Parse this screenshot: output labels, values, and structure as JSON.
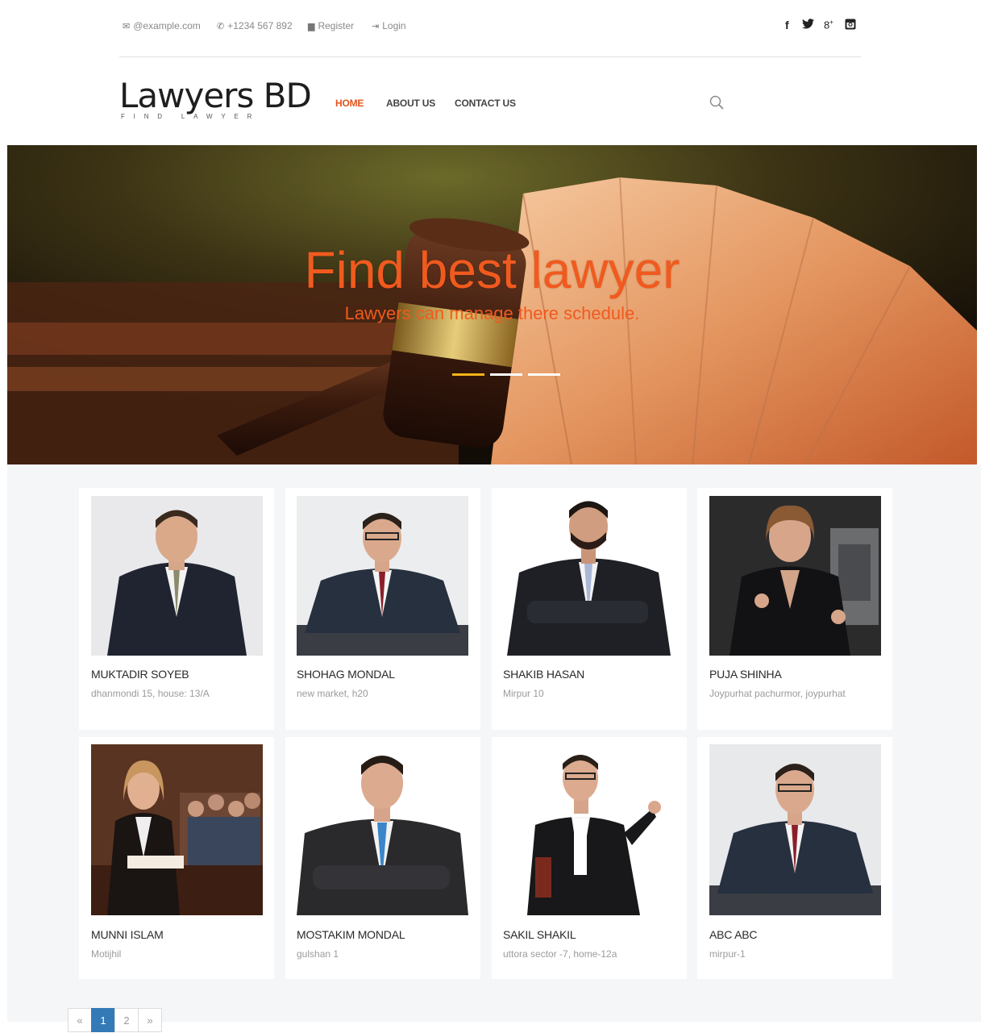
{
  "topbar": {
    "email": "@example.com",
    "phone": "+1234 567 892",
    "register": "Register",
    "login": "Login",
    "social": {
      "facebook": "f",
      "twitter": "t",
      "googleplus": "8+",
      "instagram": "ig"
    }
  },
  "brand": {
    "name": "Lawyers BD",
    "tagline": "FIND LAWYER"
  },
  "nav": {
    "home": "HOME",
    "about": "ABOUT US",
    "contact": "CONTACT US"
  },
  "hero": {
    "title": "Find best lawyer",
    "subtitle": "Lawyers can manage there schedule.",
    "active_slide": 1,
    "slide_count": 3
  },
  "lawyers": [
    {
      "name": "MUKTADIR SOYEB",
      "address": "dhanmondi 15, house: 13/A"
    },
    {
      "name": "SHOHAG MONDAL",
      "address": "new market, h20"
    },
    {
      "name": "SHAKIB HASAN",
      "address": "Mirpur 10"
    },
    {
      "name": "PUJA SHINHA",
      "address": "Joypurhat pachurmor, joypurhat"
    },
    {
      "name": "MUNNI ISLAM",
      "address": "Motijhil"
    },
    {
      "name": "MOSTAKIM MONDAL",
      "address": "gulshan 1"
    },
    {
      "name": "SAKIL SHAKIL",
      "address": "uttora sector -7, home-12a"
    },
    {
      "name": "ABC ABC",
      "address": "mirpur-1"
    }
  ],
  "pagination": {
    "prev": "«",
    "pages": [
      "1",
      "2"
    ],
    "next": "»",
    "current": "1"
  },
  "colors": {
    "accent": "#e2531d",
    "hero_text": "#f15a1e",
    "indicator_active": "#f4b41a",
    "pager_active": "#337ab7"
  }
}
